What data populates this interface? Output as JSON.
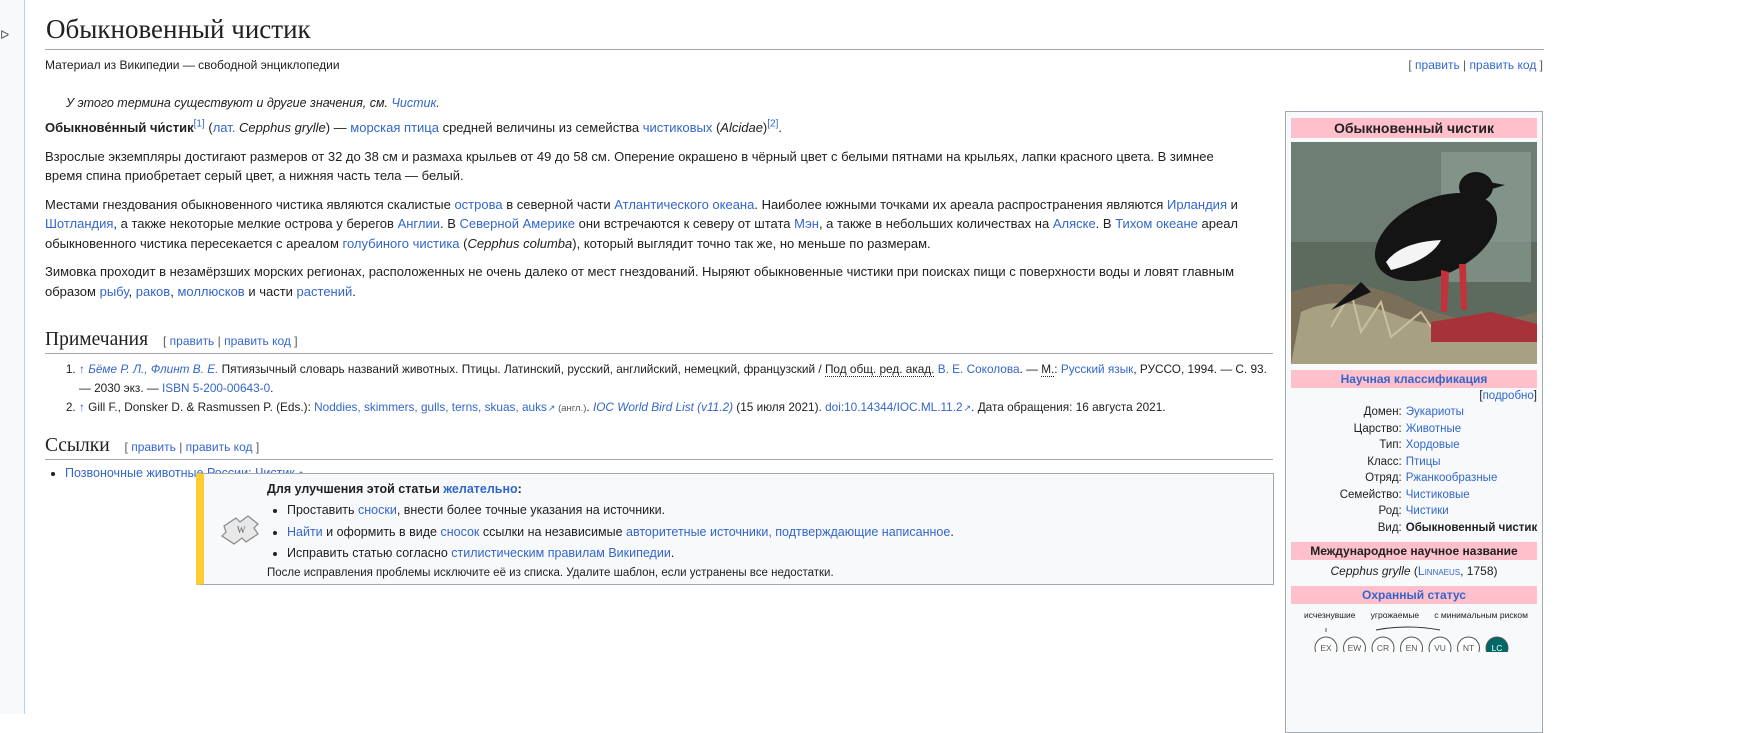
{
  "left_mark": "ᐅ",
  "title": "Обыкновенный чистик",
  "from": "Материал из Википедии — свободной энциклопедии",
  "top_edit": {
    "open": "[ ",
    "edit": "править",
    "sep": " | ",
    "edit_code": "править код",
    "close": " ]"
  },
  "hatnote": {
    "before": "У этого термина существуют и другие значения, см. ",
    "link": "Чистик",
    "after": "."
  },
  "p1": {
    "bold": "Обыкнове́нный чи́стик",
    "sup1": "[1]",
    "t1": " (",
    "lat": "лат.",
    "t2": " ",
    "latname": "Cepphus grylle",
    "t3": ") — ",
    "seabird": "морская птица",
    "t4": " средней величины из семейства ",
    "family": "чистиковых",
    "t5": " (",
    "alcidae": "Alcidae",
    "t6": ")",
    "sup2": "[2]",
    "t7": "."
  },
  "p2": "Взрослые экземпляры достигают размеров от 32 до 38 см и размаха крыльев от 49 до 58 см. Оперение окрашено в чёрный цвет с белыми пятнами на крыльях, лапки красного цвета. В зимнее время спина приобретает серый цвет, а нижняя часть тела — белый.",
  "p3": {
    "a": "Местами гнездования обыкновенного чистика являются скалистые ",
    "islands": "острова",
    "b": " в северной части ",
    "atlantic": "Атлантического океана",
    "c": ". Наиболее южными точками их ареала распространения являются ",
    "ireland": "Ирландия",
    "d": " и ",
    "scotland": "Шотландия",
    "e": ", а также некоторые мелкие острова у берегов ",
    "england": "Англии",
    "f": ". В ",
    "namerica": "Северной Америке",
    "g": " они встречаются к северу от штата ",
    "maine": "Мэн",
    "h": ", а также в небольших количествах на ",
    "alaska": "Аляске",
    "i": ". В ",
    "pacific": "Тихом океане",
    "j": " ареал обыкновенного чистика пересекается с ареалом ",
    "pigeon": "голубиного чистика",
    "k": " (",
    "columba": "Cepphus columba",
    "l": "), который выглядит точно так же, но меньше по размерам."
  },
  "p4": {
    "a": "Зимовка проходит в незамёрзших морских регионах, расположенных не очень далеко от мест гнездований. Ныряют обыкновенные чистики при поисках пищи с поверхности воды и ловят главным образом ",
    "fish": "рыбу",
    "b": ", ",
    "crayfish": "раков",
    "c": ", ",
    "molluscs": "моллюсков",
    "d": " и части ",
    "plants": "растений",
    "e": "."
  },
  "notes_head": "Примечания",
  "notes": [
    {
      "arrow": "↑",
      "authors": "Бёме Р. Л., Флинт В. Е.",
      "t1": " Пятиязычный словарь названий животных. Птицы. Латинский, русский, английский, немецкий, французский / ",
      "ed": "Под общ. ред. акад.",
      "t2": " ",
      "sokolov": "В. Е. Соколова",
      "t3": ". — ",
      "moscow": "М.",
      "t4": ": ",
      "rusyaz": "Русский язык",
      "t5": ", РУССО, 1994. — С. 93. — 2030 экз. — ",
      "isbn": "ISBN 5-200-00643-0",
      "t6": "."
    },
    {
      "arrow": "↑",
      "t1": " Gill F., Donsker D. & Rasmussen P. (Eds.): ",
      "noddies": "Noddies, skimmers, gulls, terns, skuas, auks",
      "lang": " (англ.)",
      "t2": ". ",
      "ioc": "IOC World Bird List (v11.2)",
      "t3": " (15 июля 2021). ",
      "doi": "doi:10.14344/IOC.ML.11.2",
      "t4": ". Дата обращения: 16 августа 2021."
    }
  ],
  "links_head": "Ссылки",
  "links": [
    "Позвоночные животные России: Чистик"
  ],
  "ambox": {
    "lead": "Для улучшения этой статьи ",
    "desirable": "желательно",
    "colon": ":",
    "i1a": "Проставить ",
    "i1link": "сноски",
    "i1b": ", внести более точные указания на источники.",
    "i2link1": "Найти",
    "i2a": " и оформить в виде ",
    "i2link2": "сносок",
    "i2b": " ссылки на независимые ",
    "i2link3": "авторитетные источники, подтверждающие написанное",
    "i2c": ".",
    "i3a": "Исправить статью согласно ",
    "i3link": "стилистическим правилам Википедии",
    "i3b": ".",
    "footer": "После исправления проблемы исключите её из списка. Удалите шаблон, если устранены все недостатки."
  },
  "infobox": {
    "title": "Обыкновенный чистик",
    "sci_class": "Научная классификация",
    "detail_open": "[",
    "detail": "подробно",
    "detail_close": "]",
    "rows": [
      {
        "k": "Домен:",
        "v": "Эукариоты"
      },
      {
        "k": "Царство:",
        "v": "Животные"
      },
      {
        "k": "Тип:",
        "v": "Хордовые"
      },
      {
        "k": "Класс:",
        "v": "Птицы"
      },
      {
        "k": "Отряд:",
        "v": "Ржанкообразные"
      },
      {
        "k": "Семейство:",
        "v": "Чистиковые"
      },
      {
        "k": "Род:",
        "v": "Чистики"
      },
      {
        "k": "Вид:",
        "v": "Обыкновенный чистик"
      }
    ],
    "intl_head": "Международное научное название",
    "intl_name": "Cepphus grylle",
    "intl_open": " (",
    "intl_author": "Linnaeus",
    "intl_year": ", 1758)",
    "status_head": "Охранный статус",
    "status_labels": [
      "исчезнувшие",
      "угрожаемые",
      "с минимальным риском"
    ],
    "status_codes": [
      "EX",
      "EW",
      "CR",
      "EN",
      "VU",
      "NT",
      "LC"
    ]
  }
}
